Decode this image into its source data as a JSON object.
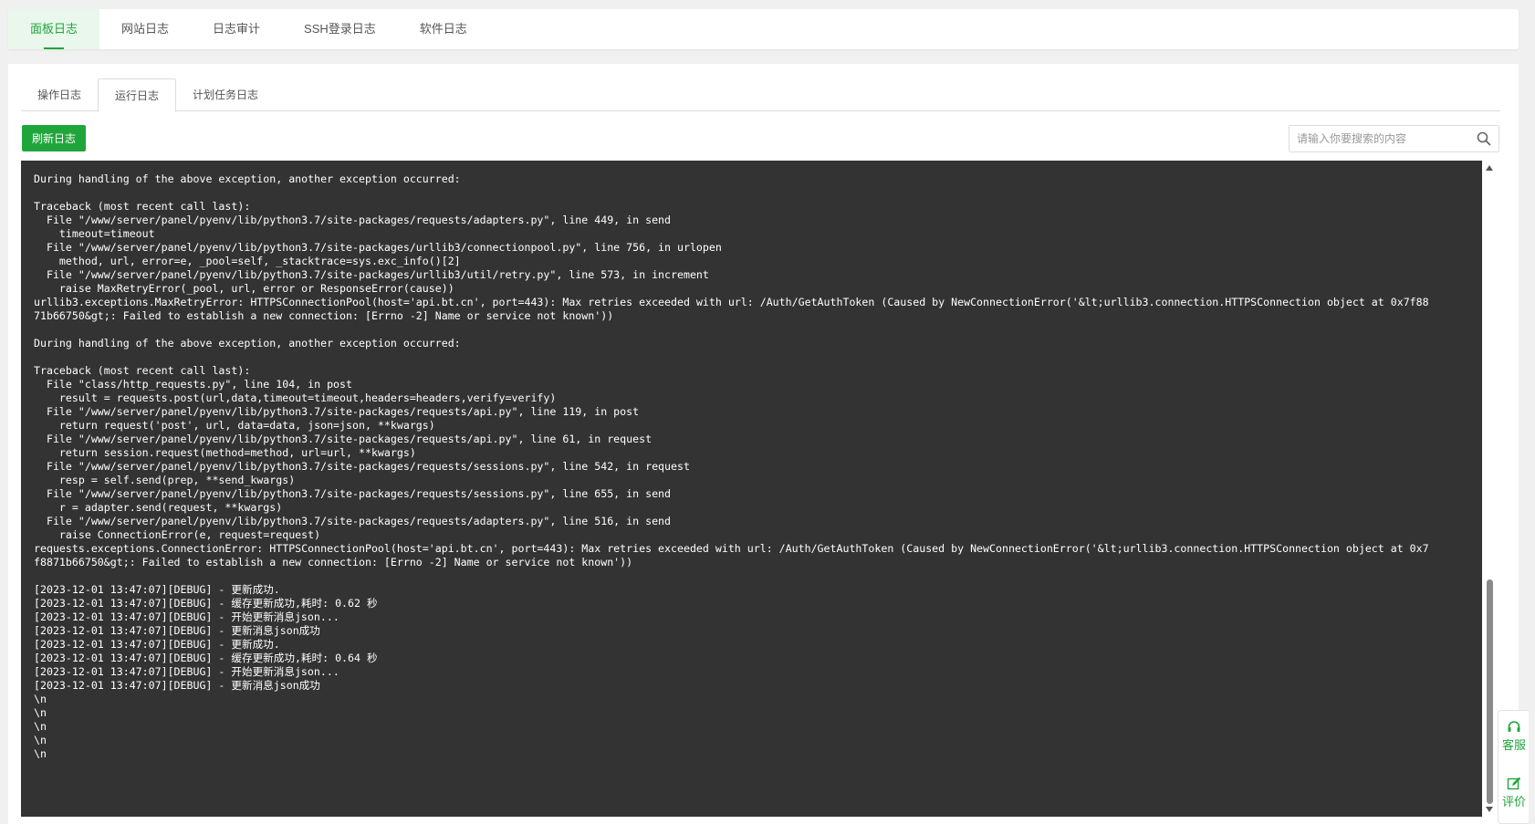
{
  "top_tabs": [
    {
      "label": "面板日志",
      "active": true
    },
    {
      "label": "网站日志",
      "active": false
    },
    {
      "label": "日志审计",
      "active": false
    },
    {
      "label": "SSH登录日志",
      "active": false
    },
    {
      "label": "软件日志",
      "active": false
    }
  ],
  "sub_tabs": [
    {
      "label": "操作日志",
      "active": false
    },
    {
      "label": "运行日志",
      "active": true
    },
    {
      "label": "计划任务日志",
      "active": false
    }
  ],
  "toolbar": {
    "refresh_label": "刷新日志",
    "search_placeholder": "请输入你要搜索的内容",
    "search_value": ""
  },
  "log_lines": [
    "During handling of the above exception, another exception occurred:",
    "",
    "Traceback (most recent call last):",
    "  File \"/www/server/panel/pyenv/lib/python3.7/site-packages/requests/adapters.py\", line 449, in send",
    "    timeout=timeout",
    "  File \"/www/server/panel/pyenv/lib/python3.7/site-packages/urllib3/connectionpool.py\", line 756, in urlopen",
    "    method, url, error=e, _pool=self, _stacktrace=sys.exc_info()[2]",
    "  File \"/www/server/panel/pyenv/lib/python3.7/site-packages/urllib3/util/retry.py\", line 573, in increment",
    "    raise MaxRetryError(_pool, url, error or ResponseError(cause))",
    "urllib3.exceptions.MaxRetryError: HTTPSConnectionPool(host='api.bt.cn', port=443): Max retries exceeded with url: /Auth/GetAuthToken (Caused by NewConnectionError('&lt;urllib3.connection.HTTPSConnection object at 0x7f88",
    "71b66750&gt;: Failed to establish a new connection: [Errno -2] Name or service not known'))",
    "",
    "During handling of the above exception, another exception occurred:",
    "",
    "Traceback (most recent call last):",
    "  File \"class/http_requests.py\", line 104, in post",
    "    result = requests.post(url,data,timeout=timeout,headers=headers,verify=verify)",
    "  File \"/www/server/panel/pyenv/lib/python3.7/site-packages/requests/api.py\", line 119, in post",
    "    return request('post', url, data=data, json=json, **kwargs)",
    "  File \"/www/server/panel/pyenv/lib/python3.7/site-packages/requests/api.py\", line 61, in request",
    "    return session.request(method=method, url=url, **kwargs)",
    "  File \"/www/server/panel/pyenv/lib/python3.7/site-packages/requests/sessions.py\", line 542, in request",
    "    resp = self.send(prep, **send_kwargs)",
    "  File \"/www/server/panel/pyenv/lib/python3.7/site-packages/requests/sessions.py\", line 655, in send",
    "    r = adapter.send(request, **kwargs)",
    "  File \"/www/server/panel/pyenv/lib/python3.7/site-packages/requests/adapters.py\", line 516, in send",
    "    raise ConnectionError(e, request=request)",
    "requests.exceptions.ConnectionError: HTTPSConnectionPool(host='api.bt.cn', port=443): Max retries exceeded with url: /Auth/GetAuthToken (Caused by NewConnectionError('&lt;urllib3.connection.HTTPSConnection object at 0x7",
    "f8871b66750&gt;: Failed to establish a new connection: [Errno -2] Name or service not known'))",
    "",
    "[2023-12-01 13:47:07][DEBUG] - 更新成功.",
    "[2023-12-01 13:47:07][DEBUG] - 缓存更新成功,耗时: 0.62 秒",
    "[2023-12-01 13:47:07][DEBUG] - 开始更新消息json...",
    "[2023-12-01 13:47:07][DEBUG] - 更新消息json成功",
    "[2023-12-01 13:47:07][DEBUG] - 更新成功.",
    "[2023-12-01 13:47:07][DEBUG] - 缓存更新成功,耗时: 0.64 秒",
    "[2023-12-01 13:47:07][DEBUG] - 开始更新消息json...",
    "[2023-12-01 13:47:07][DEBUG] - 更新消息json成功",
    "\\n",
    "\\n",
    "\\n",
    "\\n",
    "\\n"
  ],
  "service_widget": {
    "support_label": "客服",
    "review_label": "评价"
  },
  "colors": {
    "accent": "#20a53a",
    "log_background": "#333333",
    "log_text": "#ffffff"
  },
  "icons": {
    "search": "search-icon",
    "support": "headset-icon",
    "review": "edit-icon"
  }
}
